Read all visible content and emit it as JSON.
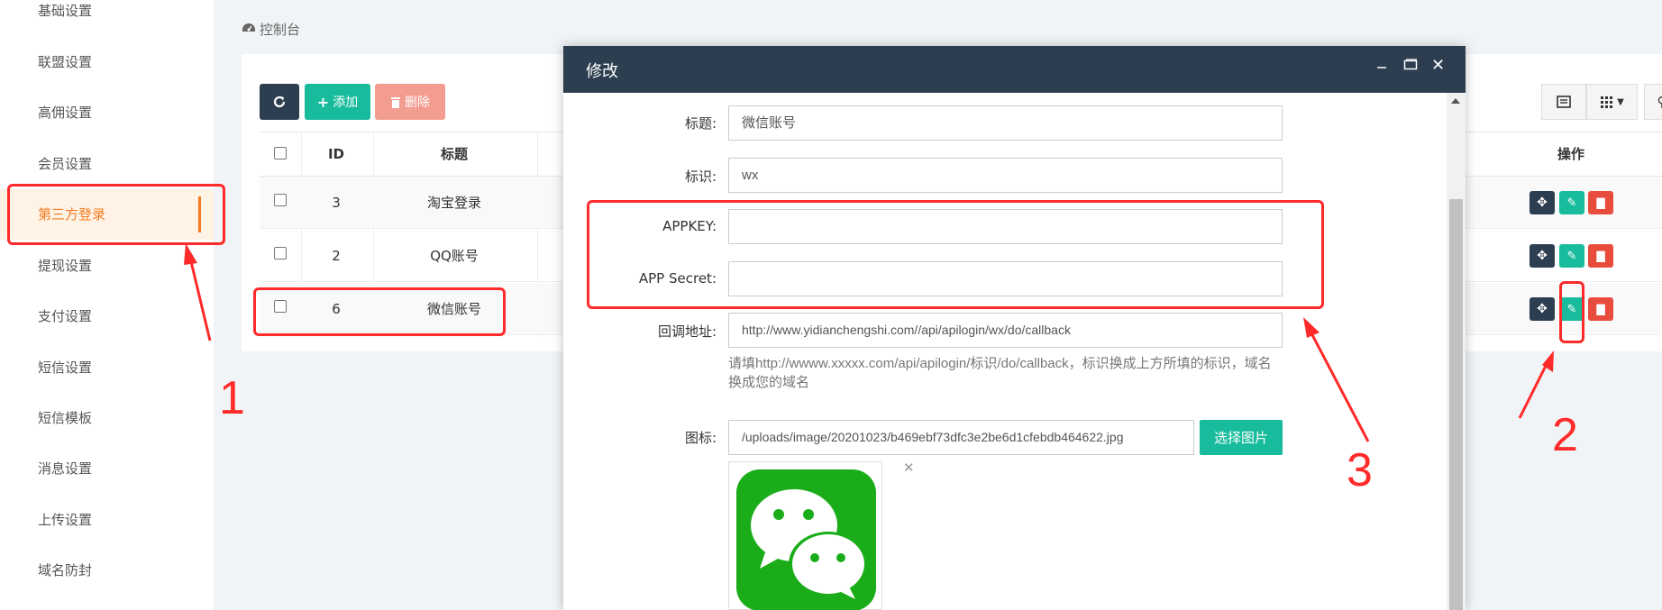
{
  "sidebar": {
    "items": [
      {
        "label": "基础设置"
      },
      {
        "label": "联盟设置"
      },
      {
        "label": "高佣设置"
      },
      {
        "label": "会员设置"
      },
      {
        "label": "第三方登录",
        "active": true
      },
      {
        "label": "提现设置"
      },
      {
        "label": "支付设置"
      },
      {
        "label": "短信设置"
      },
      {
        "label": "短信模板"
      },
      {
        "label": "消息设置"
      },
      {
        "label": "上传设置"
      },
      {
        "label": "域名防封"
      }
    ]
  },
  "breadcrumb": {
    "icon": "dashboard-icon",
    "label": "控制台"
  },
  "toolbar": {
    "add_label": "添加",
    "delete_label": "删除"
  },
  "table": {
    "headers": {
      "id": "ID",
      "title": "标题",
      "actions": "操作"
    },
    "rows": [
      {
        "id": "3",
        "title": "淘宝登录"
      },
      {
        "id": "2",
        "title": "QQ账号"
      },
      {
        "id": "6",
        "title": "微信账号"
      }
    ]
  },
  "modal": {
    "title": "修改",
    "fields": {
      "title_label": "标题:",
      "title_value": "微信账号",
      "ident_label": "标识:",
      "ident_value": "wx",
      "appkey_label": "APPKEY:",
      "appkey_value": "",
      "secret_label": "APP Secret:",
      "secret_value": "",
      "callback_label": "回调地址:",
      "callback_value": "http://www.yidianchengshi.com//api/apilogin/wx/do/callback",
      "callback_hint_1": "请填http://wwww.xxxxx.com/api/apilogin/标识/do/callback，标识换成上方所填的标识，域名",
      "callback_hint_2": "换成您的域名",
      "icon_label": "图标:",
      "icon_value": "/uploads/image/20201023/b469ebf73dfc3e2be6d1cfebdb464622.jpg",
      "choose_image_label": "选择图片"
    }
  },
  "annotations": {
    "n1": "1",
    "n2": "2",
    "n3": "3"
  },
  "colors": {
    "accent": "#18bc9c",
    "dark": "#2c3e50",
    "danger": "#e74c3c",
    "active": "#f47b20",
    "annotation": "#ff2a2a",
    "wechat": "#1aad19"
  }
}
